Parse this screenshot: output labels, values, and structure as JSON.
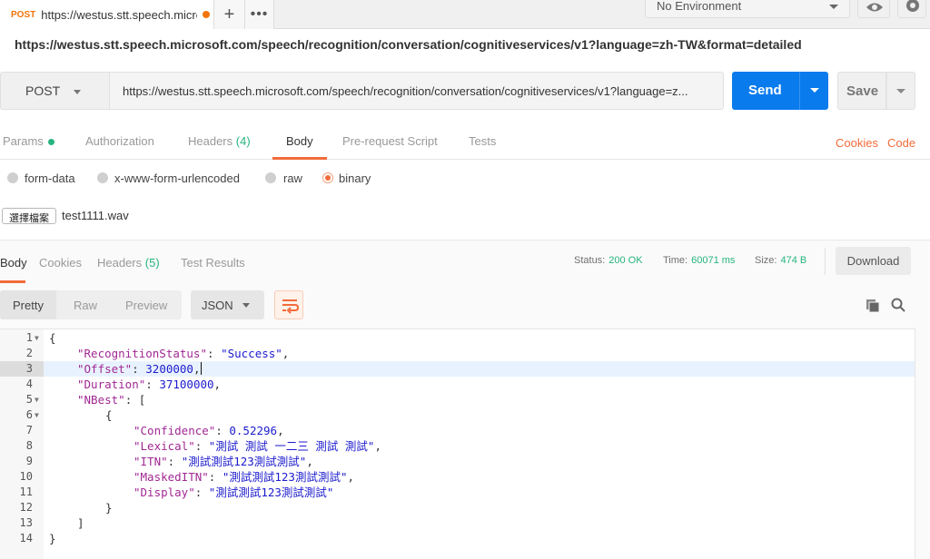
{
  "tab": {
    "method": "POST",
    "title": "https://westus.stt.speech.micro"
  },
  "environment": {
    "selected": "No Environment"
  },
  "request": {
    "full_url": "https://westus.stt.speech.microsoft.com/speech/recognition/conversation/cognitiveservices/v1?language=zh-TW&format=detailed",
    "method": "POST",
    "url_display": "https://westus.stt.speech.microsoft.com/speech/recognition/conversation/cognitiveservices/v1?language=z...",
    "send_label": "Send",
    "save_label": "Save"
  },
  "request_tabs": {
    "params": "Params",
    "authorization": "Authorization",
    "headers": "Headers",
    "headers_count": "(4)",
    "body": "Body",
    "prerequest": "Pre-request Script",
    "tests": "Tests",
    "cookies": "Cookies",
    "code": "Code"
  },
  "body_types": {
    "form_data": "form-data",
    "urlencoded": "x-www-form-urlencoded",
    "raw": "raw",
    "binary": "binary",
    "selected": "binary"
  },
  "file": {
    "button_label": "選擇檔案",
    "name": "test1111.wav"
  },
  "response_tabs": {
    "body": "Body",
    "cookies": "Cookies",
    "headers": "Headers",
    "headers_count": "(5)",
    "test_results": "Test Results"
  },
  "status": {
    "status_label": "Status:",
    "status_value": "200 OK",
    "time_label": "Time:",
    "time_value": "60071 ms",
    "size_label": "Size:",
    "size_value": "474 B",
    "download_label": "Download"
  },
  "view": {
    "pretty": "Pretty",
    "raw": "Raw",
    "preview": "Preview",
    "format": "JSON"
  },
  "code_lines": [
    {
      "num": "1",
      "fold": true,
      "text": "{"
    },
    {
      "num": "2",
      "fold": false,
      "key": "\"RecognitionStatus\"",
      "sep": ": ",
      "str": "\"Success\"",
      "tail": ","
    },
    {
      "num": "3",
      "fold": false,
      "key": "\"Offset\"",
      "sep": ": ",
      "num_val": "3200000",
      "tail": ",",
      "cursor": true,
      "highlight": true
    },
    {
      "num": "4",
      "fold": false,
      "key": "\"Duration\"",
      "sep": ": ",
      "num_val": "37100000",
      "tail": ","
    },
    {
      "num": "5",
      "fold": true,
      "key": "\"NBest\"",
      "sep": ": ",
      "tail": "["
    },
    {
      "num": "6",
      "fold": true,
      "text": "{"
    },
    {
      "num": "7",
      "fold": false,
      "key": "\"Confidence\"",
      "sep": ": ",
      "num_val": "0.52296",
      "tail": ","
    },
    {
      "num": "8",
      "fold": false,
      "key": "\"Lexical\"",
      "sep": ": ",
      "str": "\"測試 測試 一二三 測試 測試\"",
      "tail": ","
    },
    {
      "num": "9",
      "fold": false,
      "key": "\"ITN\"",
      "sep": ": ",
      "str": "\"測試測試123測試測試\"",
      "tail": ","
    },
    {
      "num": "10",
      "fold": false,
      "key": "\"MaskedITN\"",
      "sep": ": ",
      "str": "\"測試測試123測試測試\"",
      "tail": ","
    },
    {
      "num": "11",
      "fold": false,
      "key": "\"Display\"",
      "sep": ": ",
      "str": "\"測試測試123測試測試\"",
      "tail": ""
    },
    {
      "num": "12",
      "fold": false,
      "text": "}"
    },
    {
      "num": "13",
      "fold": false,
      "text": "]"
    },
    {
      "num": "14",
      "fold": false,
      "text": "}"
    }
  ],
  "colors": {
    "accent": "#f26b3a",
    "send": "#097bed",
    "status_ok": "#26b47f",
    "json_key": "#a12893",
    "json_string": "#1c1bcd"
  }
}
